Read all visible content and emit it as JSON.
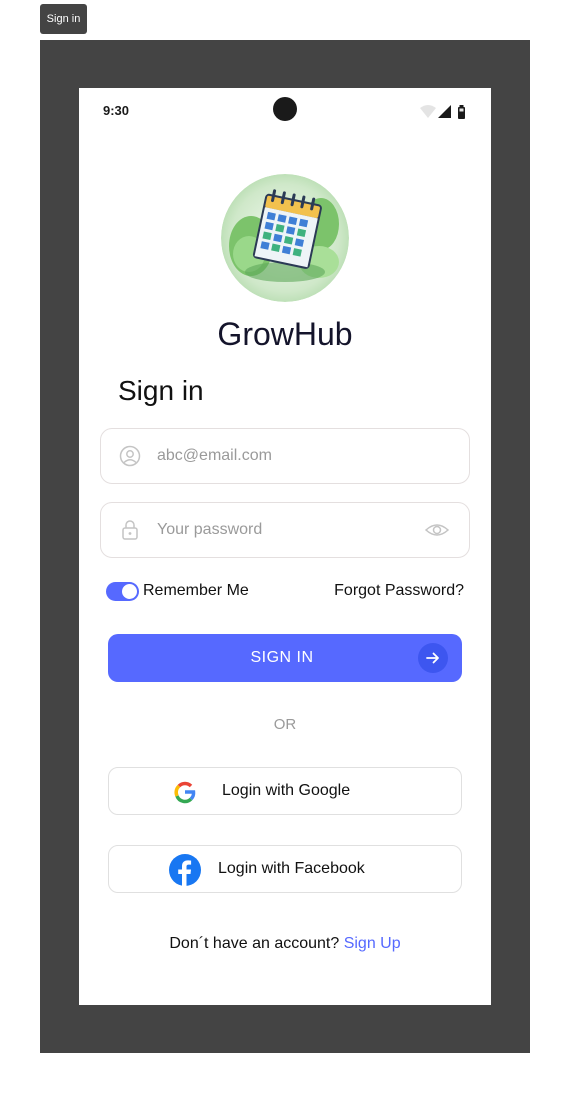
{
  "frame": {
    "label": "Sign in"
  },
  "status_bar": {
    "time": "9:30"
  },
  "app": {
    "name": "GrowHub"
  },
  "page": {
    "title": "Sign in"
  },
  "email_field": {
    "placeholder": "abc@email.com",
    "value": ""
  },
  "password_field": {
    "placeholder": "Your password",
    "value": ""
  },
  "remember_me": {
    "label": "Remember Me",
    "checked": true
  },
  "forgot_password": {
    "label": "Forgot Password?"
  },
  "sign_in_button": {
    "label": "SIGN IN"
  },
  "divider": {
    "label": "OR"
  },
  "google_button": {
    "label": "Login with Google"
  },
  "facebook_button": {
    "label": "Login with Facebook"
  },
  "signup": {
    "prompt": "Don´t have an account?",
    "link": "Sign Up"
  },
  "colors": {
    "accent": "#5669ff",
    "frame": "#444444",
    "facebook": "#1877f2"
  },
  "icons": [
    "wifi-icon",
    "signal-icon",
    "battery-icon",
    "user-icon",
    "lock-icon",
    "eye-icon",
    "arrow-right-icon",
    "google-icon",
    "facebook-icon"
  ]
}
